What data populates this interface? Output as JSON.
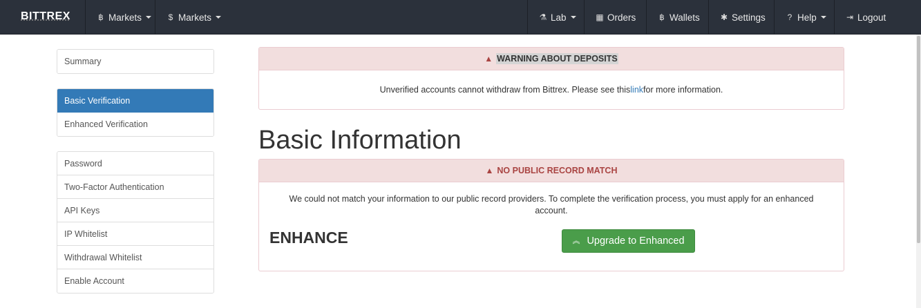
{
  "navbar": {
    "brand": "BITTREX",
    "left": [
      {
        "icon": "bitcoin-icon",
        "glyph": "฿",
        "label": "Markets"
      },
      {
        "icon": "dollar-icon",
        "glyph": "$",
        "label": "Markets"
      }
    ],
    "right": [
      {
        "icon": "flask-icon",
        "glyph": "⚗",
        "label": "Lab",
        "dropdown": true
      },
      {
        "icon": "calendar-icon",
        "glyph": "▦",
        "label": "Orders"
      },
      {
        "icon": "bitcoin-icon",
        "glyph": "฿",
        "label": "Wallets"
      },
      {
        "icon": "gear-icon",
        "glyph": "✱",
        "label": "Settings"
      },
      {
        "icon": "question-icon",
        "glyph": "?",
        "label": "Help",
        "dropdown": true
      },
      {
        "icon": "logout-icon",
        "glyph": "⇥",
        "label": "Logout"
      }
    ]
  },
  "sidebar": {
    "group1": [
      "Summary"
    ],
    "group2": [
      "Basic Verification",
      "Enhanced Verification"
    ],
    "group3": [
      "Password",
      "Two-Factor Authentication",
      "API Keys",
      "IP Whitelist",
      "Withdrawal Whitelist",
      "Enable Account"
    ]
  },
  "warning": {
    "title": "WARNING ABOUT DEPOSITS",
    "text_before": "Unverified accounts cannot withdraw from Bittrex. Please see this ",
    "link": "link",
    "text_after": " for more information."
  },
  "page_title": "Basic Information",
  "record": {
    "title": "NO PUBLIC RECORD MATCH",
    "text": "We could not match your information to our public record providers. To complete the verification process, you must apply for an enhanced account.",
    "enhance_label": "ENHANCE",
    "button_label": "Upgrade to Enhanced"
  },
  "colors": {
    "navbar": "#2b313b",
    "active": "#337ab7",
    "danger_bg": "#f2dede",
    "success": "#4a9d4a"
  }
}
